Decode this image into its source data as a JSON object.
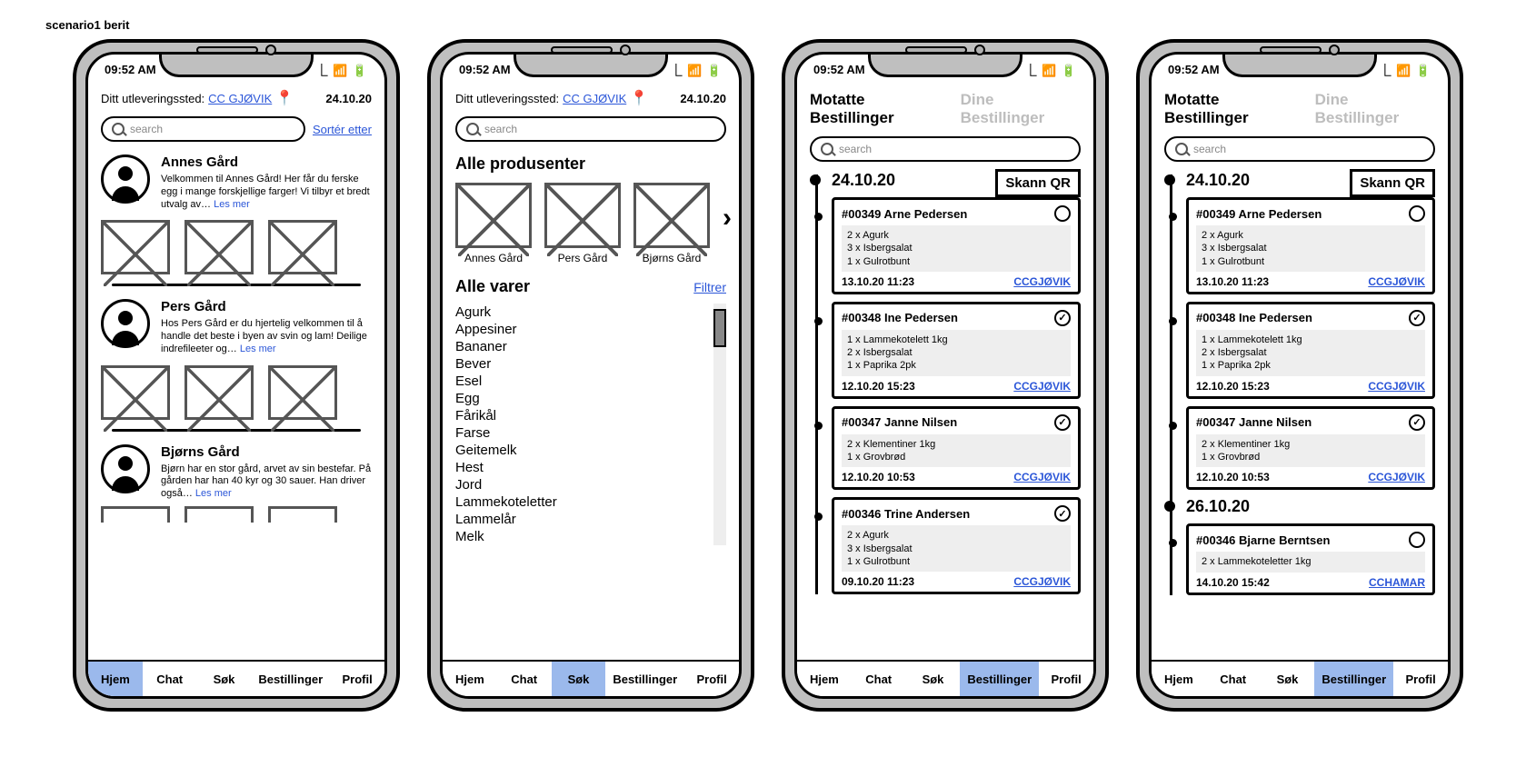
{
  "page_title": "scenario1 berit",
  "status": {
    "time": "09:52 AM",
    "icons": "⎿ 📶 🔋"
  },
  "delivery": {
    "label": "Ditt utleveringssted:",
    "location": "CC GJØVIK",
    "date": "24.10.20"
  },
  "search_placeholder": "search",
  "sort_label": "Sortér etter",
  "les_mer": "Les mer",
  "screen1_farms": [
    {
      "name": "Annes Gård",
      "desc": "Velkommen til Annes Gård! Her får du ferske egg i mange forskjellige farger! Vi tilbyr et bredt utvalg av…"
    },
    {
      "name": "Pers Gård",
      "desc": "Hos Pers Gård er du hjertelig velkommen til å handle det beste i byen av svin og lam! Deilige indrefileeter og…"
    },
    {
      "name": "Bjørns Gård",
      "desc": "Bjørn har en stor gård, arvet av sin bestefar. På gården har han 40 kyr og 30 sauer. Han driver også…"
    }
  ],
  "screen2": {
    "all_producers_heading": "Alle produsenter",
    "producers": [
      "Annes Gård",
      "Pers Gård",
      "Bjørns Gård"
    ],
    "all_items_heading": "Alle varer",
    "filter_label": "Filtrer",
    "items": [
      "Agurk",
      "Appesiner",
      "Bananer",
      "Bever",
      "Esel",
      "Egg",
      "Fårikål",
      "Farse",
      "Geitemelk",
      "Hest",
      "Jord",
      "Lammekoteletter",
      "Lammelår",
      "Melk"
    ]
  },
  "orders_tabs": {
    "active": "Motatte Bestillinger",
    "inactive": "Dine Bestillinger"
  },
  "scan_qr": "Skann QR",
  "screen3": {
    "date": "24.10.20",
    "orders": [
      {
        "id": "#00349",
        "customer": "Arne Pedersen",
        "items": [
          "2 x Agurk",
          "3 x Isbergsalat",
          "1 x Gulrotbunt"
        ],
        "time": "13.10.20 11:23",
        "loc": "CCGJØVIK",
        "done": false
      },
      {
        "id": "#00348",
        "customer": "Ine Pedersen",
        "items": [
          "1 x Lammekotelett 1kg",
          "2 x Isbergsalat",
          "1 x Paprika 2pk"
        ],
        "time": "12.10.20 15:23",
        "loc": "CCGJØVIK",
        "done": true
      },
      {
        "id": "#00347",
        "customer": "Janne Nilsen",
        "items": [
          "2 x Klementiner 1kg",
          "1 x Grovbrød"
        ],
        "time": "12.10.20 10:53",
        "loc": "CCGJØVIK",
        "done": true
      },
      {
        "id": "#00346",
        "customer": "Trine Andersen",
        "items": [
          "2 x Agurk",
          "3 x Isbergsalat",
          "1 x Gulrotbunt"
        ],
        "time": "09.10.20 11:23",
        "loc": "CCGJØVIK",
        "done": true
      }
    ]
  },
  "screen4": {
    "groups": [
      {
        "date": "24.10.20",
        "orders": [
          {
            "id": "#00349",
            "customer": "Arne Pedersen",
            "items": [
              "2 x Agurk",
              "3 x Isbergsalat",
              "1 x Gulrotbunt"
            ],
            "time": "13.10.20 11:23",
            "loc": "CCGJØVIK",
            "done": false
          },
          {
            "id": "#00348",
            "customer": "Ine Pedersen",
            "items": [
              "1 x Lammekotelett 1kg",
              "2 x Isbergsalat",
              "1 x Paprika 2pk"
            ],
            "time": "12.10.20 15:23",
            "loc": "CCGJØVIK",
            "done": true
          },
          {
            "id": "#00347",
            "customer": "Janne Nilsen",
            "items": [
              "2 x Klementiner 1kg",
              "1 x Grovbrød"
            ],
            "time": "12.10.20 10:53",
            "loc": "CCGJØVIK",
            "done": true
          }
        ]
      },
      {
        "date": "26.10.20",
        "orders": [
          {
            "id": "#00346",
            "customer": "Bjarne Berntsen",
            "items": [
              "2 x Lammekoteletter 1kg"
            ],
            "time": "14.10.20 15:42",
            "loc": "CCHAMAR",
            "done": false
          }
        ]
      }
    ]
  },
  "nav": {
    "hjem": "Hjem",
    "chat": "Chat",
    "sok": "Søk",
    "bestillinger": "Bestillinger",
    "profil": "Profil"
  }
}
